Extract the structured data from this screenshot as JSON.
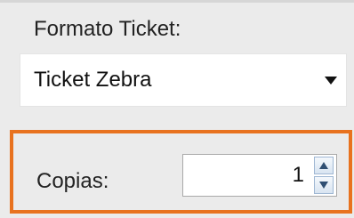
{
  "ticket_format": {
    "label": "Formato Ticket:",
    "selected_value": "Ticket Zebra",
    "arrow_icon": "chevron-down-icon"
  },
  "copies": {
    "label": "Copias:",
    "value": "1",
    "highlight_color": "#e8721f",
    "increment_icon": "arrow-up-icon",
    "decrement_icon": "arrow-down-icon"
  }
}
